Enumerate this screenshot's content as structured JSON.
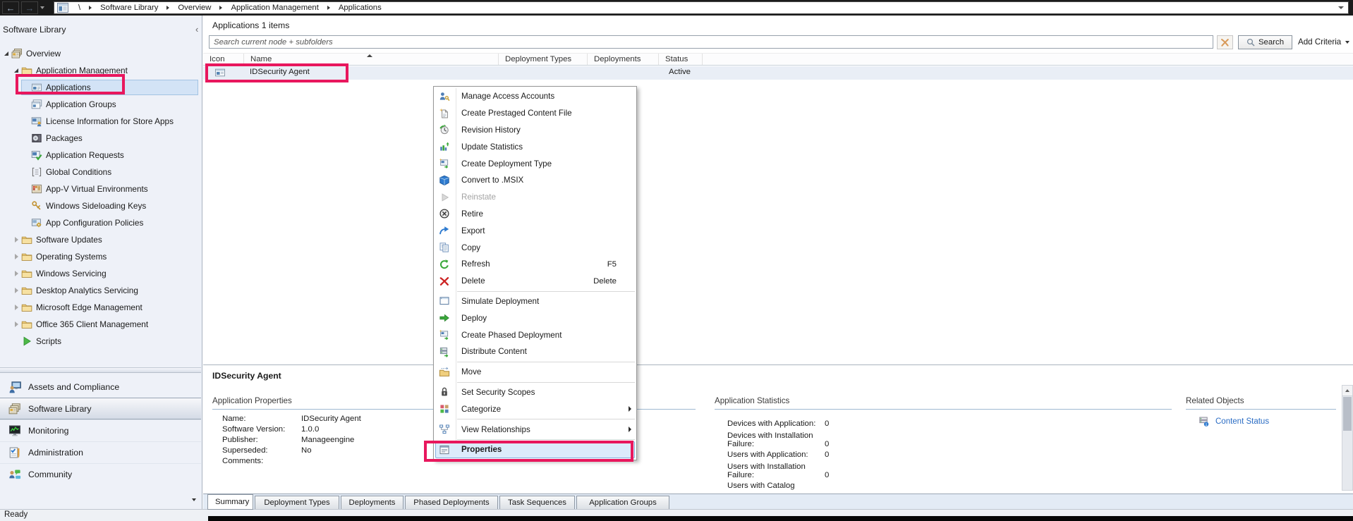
{
  "window": {
    "breadcrumb_root": "\\",
    "breadcrumbs": [
      "Software Library",
      "Overview",
      "Application Management",
      "Applications"
    ]
  },
  "sidebar": {
    "title": "Software Library",
    "tree": [
      {
        "label": "Overview",
        "icon": "overview",
        "level": 0,
        "state": "expanded"
      },
      {
        "label": "Application Management",
        "icon": "folder",
        "level": 1,
        "state": "expanded"
      },
      {
        "label": "Applications",
        "icon": "applications",
        "level": 2,
        "state": "none",
        "selected": true,
        "annotated": true
      },
      {
        "label": "Application Groups",
        "icon": "application-groups",
        "level": 2,
        "state": "none"
      },
      {
        "label": "License Information for Store Apps",
        "icon": "license-information",
        "level": 2,
        "state": "none"
      },
      {
        "label": "Packages",
        "icon": "packages",
        "level": 2,
        "state": "none"
      },
      {
        "label": "Application Requests",
        "icon": "application-requests",
        "level": 2,
        "state": "none"
      },
      {
        "label": "Global Conditions",
        "icon": "global-conditions",
        "level": 2,
        "state": "none"
      },
      {
        "label": "App-V Virtual Environments",
        "icon": "appv-virtual-environments",
        "level": 2,
        "state": "none"
      },
      {
        "label": "Windows Sideloading Keys",
        "icon": "sideloading-keys",
        "level": 2,
        "state": "none"
      },
      {
        "label": "App Configuration Policies",
        "icon": "app-configuration-policies",
        "level": 2,
        "state": "none"
      },
      {
        "label": "Software Updates",
        "icon": "folder",
        "level": 1,
        "state": "collapsed"
      },
      {
        "label": "Operating Systems",
        "icon": "folder",
        "level": 1,
        "state": "collapsed"
      },
      {
        "label": "Windows Servicing",
        "icon": "folder",
        "level": 1,
        "state": "collapsed"
      },
      {
        "label": "Desktop Analytics Servicing",
        "icon": "folder",
        "level": 1,
        "state": "collapsed"
      },
      {
        "label": "Microsoft Edge Management",
        "icon": "folder",
        "level": 1,
        "state": "collapsed"
      },
      {
        "label": "Office 365 Client Management",
        "icon": "folder",
        "level": 1,
        "state": "collapsed"
      },
      {
        "label": "Scripts",
        "icon": "scripts",
        "level": 1,
        "state": "none"
      }
    ],
    "workspaces": [
      {
        "label": "Assets and Compliance",
        "icon": "assets-and-compliance"
      },
      {
        "label": "Software Library",
        "icon": "software-library",
        "selected": true
      },
      {
        "label": "Monitoring",
        "icon": "monitoring"
      },
      {
        "label": "Administration",
        "icon": "administration"
      },
      {
        "label": "Community",
        "icon": "community"
      }
    ]
  },
  "main": {
    "header": "Applications 1 items",
    "search": {
      "placeholder": "Search current node + subfolders",
      "search_label": "Search",
      "add_criteria_label": "Add Criteria"
    },
    "table": {
      "columns": [
        "Icon",
        "Name",
        "Deployment Types",
        "Deployments",
        "Status"
      ],
      "sorted_column": "Name",
      "rows": [
        {
          "icon": "application",
          "name": "IDSecurity Agent",
          "deployment_types": "",
          "deployments": "",
          "status": "Active",
          "selected": true,
          "annotated": true
        }
      ]
    }
  },
  "context_menu": {
    "items": [
      {
        "label": "Manage Access Accounts",
        "icon": "manage-access-accounts"
      },
      {
        "label": "Create Prestaged Content File",
        "icon": "create-prestaged-content-file"
      },
      {
        "label": "Revision History",
        "icon": "revision-history"
      },
      {
        "label": "Update Statistics",
        "icon": "update-statistics"
      },
      {
        "label": "Create Deployment Type",
        "icon": "create-deployment-type"
      },
      {
        "label": "Convert to .MSIX",
        "icon": "convert-to-msix"
      },
      {
        "label": "Reinstate",
        "icon": "reinstate",
        "disabled": true
      },
      {
        "label": "Retire",
        "icon": "retire"
      },
      {
        "label": "Export",
        "icon": "export"
      },
      {
        "label": "Copy",
        "icon": "copy"
      },
      {
        "label": "Refresh",
        "icon": "refresh",
        "shortcut": "F5"
      },
      {
        "label": "Delete",
        "icon": "delete",
        "shortcut": "Delete"
      },
      {
        "separator": true
      },
      {
        "label": "Simulate Deployment",
        "icon": "simulate-deployment"
      },
      {
        "label": "Deploy",
        "icon": "deploy"
      },
      {
        "label": "Create Phased Deployment",
        "icon": "create-phased-deployment"
      },
      {
        "label": "Distribute Content",
        "icon": "distribute-content"
      },
      {
        "separator": true
      },
      {
        "label": "Move",
        "icon": "move"
      },
      {
        "separator": true
      },
      {
        "label": "Set Security Scopes",
        "icon": "set-security-scopes"
      },
      {
        "label": "Categorize",
        "icon": "categorize",
        "submenu": true
      },
      {
        "separator": true
      },
      {
        "label": "View Relationships",
        "icon": "view-relationships",
        "submenu": true
      },
      {
        "separator": true
      },
      {
        "label": "Properties",
        "icon": "properties",
        "highlighted": true,
        "bold": true,
        "annotated": true
      }
    ]
  },
  "details": {
    "title": "IDSecurity Agent",
    "application_properties": {
      "heading": "Application Properties",
      "fields": [
        {
          "label": "Name:",
          "value": "IDSecurity Agent"
        },
        {
          "label": "Software Version:",
          "value": "1.0.0"
        },
        {
          "label": "Publisher:",
          "value": "Manageengine"
        },
        {
          "label": "Superseded:",
          "value": "No"
        },
        {
          "label": "Comments:",
          "value": ""
        }
      ]
    },
    "application_statistics": {
      "heading": "Application Statistics",
      "fields": [
        {
          "label": "Devices with Application:",
          "value": "0"
        },
        {
          "label": "Devices with Installation Failure:",
          "value": "0"
        },
        {
          "label": "Users with Application:",
          "value": "0"
        },
        {
          "label": "Users with Installation Failure:",
          "value": "0"
        },
        {
          "label": "Users with Catalog",
          "value": ""
        }
      ]
    },
    "related_objects": {
      "heading": "Related Objects",
      "links": [
        {
          "label": "Content Status",
          "icon": "content-status"
        }
      ]
    }
  },
  "tabs": [
    {
      "label": "Summary",
      "active": true
    },
    {
      "label": "Deployment Types"
    },
    {
      "label": "Deployments"
    },
    {
      "label": "Phased Deployments"
    },
    {
      "label": "Task Sequences"
    },
    {
      "label": "Application Groups"
    }
  ],
  "statusbar": {
    "text": "Ready"
  },
  "colors": {
    "annotation": "#e8175d",
    "selection": "#d3e3f6",
    "link": "#2a6cc4"
  }
}
